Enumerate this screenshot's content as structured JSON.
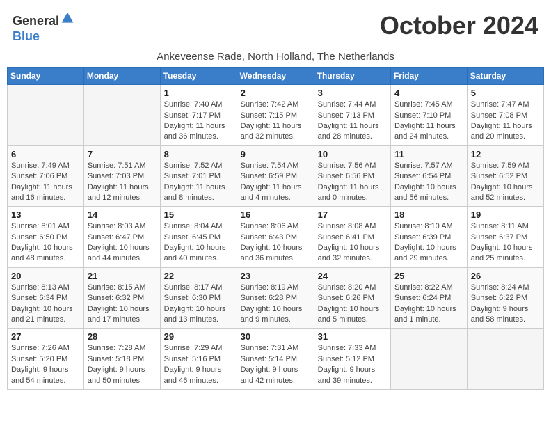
{
  "header": {
    "logo_line1": "General",
    "logo_line2": "Blue",
    "month_title": "October 2024",
    "location": "Ankeveense Rade, North Holland, The Netherlands"
  },
  "weekdays": [
    "Sunday",
    "Monday",
    "Tuesday",
    "Wednesday",
    "Thursday",
    "Friday",
    "Saturday"
  ],
  "weeks": [
    [
      {
        "day": "",
        "sunrise": "",
        "sunset": "",
        "daylight": ""
      },
      {
        "day": "",
        "sunrise": "",
        "sunset": "",
        "daylight": ""
      },
      {
        "day": "1",
        "sunrise": "Sunrise: 7:40 AM",
        "sunset": "Sunset: 7:17 PM",
        "daylight": "Daylight: 11 hours and 36 minutes."
      },
      {
        "day": "2",
        "sunrise": "Sunrise: 7:42 AM",
        "sunset": "Sunset: 7:15 PM",
        "daylight": "Daylight: 11 hours and 32 minutes."
      },
      {
        "day": "3",
        "sunrise": "Sunrise: 7:44 AM",
        "sunset": "Sunset: 7:13 PM",
        "daylight": "Daylight: 11 hours and 28 minutes."
      },
      {
        "day": "4",
        "sunrise": "Sunrise: 7:45 AM",
        "sunset": "Sunset: 7:10 PM",
        "daylight": "Daylight: 11 hours and 24 minutes."
      },
      {
        "day": "5",
        "sunrise": "Sunrise: 7:47 AM",
        "sunset": "Sunset: 7:08 PM",
        "daylight": "Daylight: 11 hours and 20 minutes."
      }
    ],
    [
      {
        "day": "6",
        "sunrise": "Sunrise: 7:49 AM",
        "sunset": "Sunset: 7:06 PM",
        "daylight": "Daylight: 11 hours and 16 minutes."
      },
      {
        "day": "7",
        "sunrise": "Sunrise: 7:51 AM",
        "sunset": "Sunset: 7:03 PM",
        "daylight": "Daylight: 11 hours and 12 minutes."
      },
      {
        "day": "8",
        "sunrise": "Sunrise: 7:52 AM",
        "sunset": "Sunset: 7:01 PM",
        "daylight": "Daylight: 11 hours and 8 minutes."
      },
      {
        "day": "9",
        "sunrise": "Sunrise: 7:54 AM",
        "sunset": "Sunset: 6:59 PM",
        "daylight": "Daylight: 11 hours and 4 minutes."
      },
      {
        "day": "10",
        "sunrise": "Sunrise: 7:56 AM",
        "sunset": "Sunset: 6:56 PM",
        "daylight": "Daylight: 11 hours and 0 minutes."
      },
      {
        "day": "11",
        "sunrise": "Sunrise: 7:57 AM",
        "sunset": "Sunset: 6:54 PM",
        "daylight": "Daylight: 10 hours and 56 minutes."
      },
      {
        "day": "12",
        "sunrise": "Sunrise: 7:59 AM",
        "sunset": "Sunset: 6:52 PM",
        "daylight": "Daylight: 10 hours and 52 minutes."
      }
    ],
    [
      {
        "day": "13",
        "sunrise": "Sunrise: 8:01 AM",
        "sunset": "Sunset: 6:50 PM",
        "daylight": "Daylight: 10 hours and 48 minutes."
      },
      {
        "day": "14",
        "sunrise": "Sunrise: 8:03 AM",
        "sunset": "Sunset: 6:47 PM",
        "daylight": "Daylight: 10 hours and 44 minutes."
      },
      {
        "day": "15",
        "sunrise": "Sunrise: 8:04 AM",
        "sunset": "Sunset: 6:45 PM",
        "daylight": "Daylight: 10 hours and 40 minutes."
      },
      {
        "day": "16",
        "sunrise": "Sunrise: 8:06 AM",
        "sunset": "Sunset: 6:43 PM",
        "daylight": "Daylight: 10 hours and 36 minutes."
      },
      {
        "day": "17",
        "sunrise": "Sunrise: 8:08 AM",
        "sunset": "Sunset: 6:41 PM",
        "daylight": "Daylight: 10 hours and 32 minutes."
      },
      {
        "day": "18",
        "sunrise": "Sunrise: 8:10 AM",
        "sunset": "Sunset: 6:39 PM",
        "daylight": "Daylight: 10 hours and 29 minutes."
      },
      {
        "day": "19",
        "sunrise": "Sunrise: 8:11 AM",
        "sunset": "Sunset: 6:37 PM",
        "daylight": "Daylight: 10 hours and 25 minutes."
      }
    ],
    [
      {
        "day": "20",
        "sunrise": "Sunrise: 8:13 AM",
        "sunset": "Sunset: 6:34 PM",
        "daylight": "Daylight: 10 hours and 21 minutes."
      },
      {
        "day": "21",
        "sunrise": "Sunrise: 8:15 AM",
        "sunset": "Sunset: 6:32 PM",
        "daylight": "Daylight: 10 hours and 17 minutes."
      },
      {
        "day": "22",
        "sunrise": "Sunrise: 8:17 AM",
        "sunset": "Sunset: 6:30 PM",
        "daylight": "Daylight: 10 hours and 13 minutes."
      },
      {
        "day": "23",
        "sunrise": "Sunrise: 8:19 AM",
        "sunset": "Sunset: 6:28 PM",
        "daylight": "Daylight: 10 hours and 9 minutes."
      },
      {
        "day": "24",
        "sunrise": "Sunrise: 8:20 AM",
        "sunset": "Sunset: 6:26 PM",
        "daylight": "Daylight: 10 hours and 5 minutes."
      },
      {
        "day": "25",
        "sunrise": "Sunrise: 8:22 AM",
        "sunset": "Sunset: 6:24 PM",
        "daylight": "Daylight: 10 hours and 1 minute."
      },
      {
        "day": "26",
        "sunrise": "Sunrise: 8:24 AM",
        "sunset": "Sunset: 6:22 PM",
        "daylight": "Daylight: 9 hours and 58 minutes."
      }
    ],
    [
      {
        "day": "27",
        "sunrise": "Sunrise: 7:26 AM",
        "sunset": "Sunset: 5:20 PM",
        "daylight": "Daylight: 9 hours and 54 minutes."
      },
      {
        "day": "28",
        "sunrise": "Sunrise: 7:28 AM",
        "sunset": "Sunset: 5:18 PM",
        "daylight": "Daylight: 9 hours and 50 minutes."
      },
      {
        "day": "29",
        "sunrise": "Sunrise: 7:29 AM",
        "sunset": "Sunset: 5:16 PM",
        "daylight": "Daylight: 9 hours and 46 minutes."
      },
      {
        "day": "30",
        "sunrise": "Sunrise: 7:31 AM",
        "sunset": "Sunset: 5:14 PM",
        "daylight": "Daylight: 9 hours and 42 minutes."
      },
      {
        "day": "31",
        "sunrise": "Sunrise: 7:33 AM",
        "sunset": "Sunset: 5:12 PM",
        "daylight": "Daylight: 9 hours and 39 minutes."
      },
      {
        "day": "",
        "sunrise": "",
        "sunset": "",
        "daylight": ""
      },
      {
        "day": "",
        "sunrise": "",
        "sunset": "",
        "daylight": ""
      }
    ]
  ]
}
